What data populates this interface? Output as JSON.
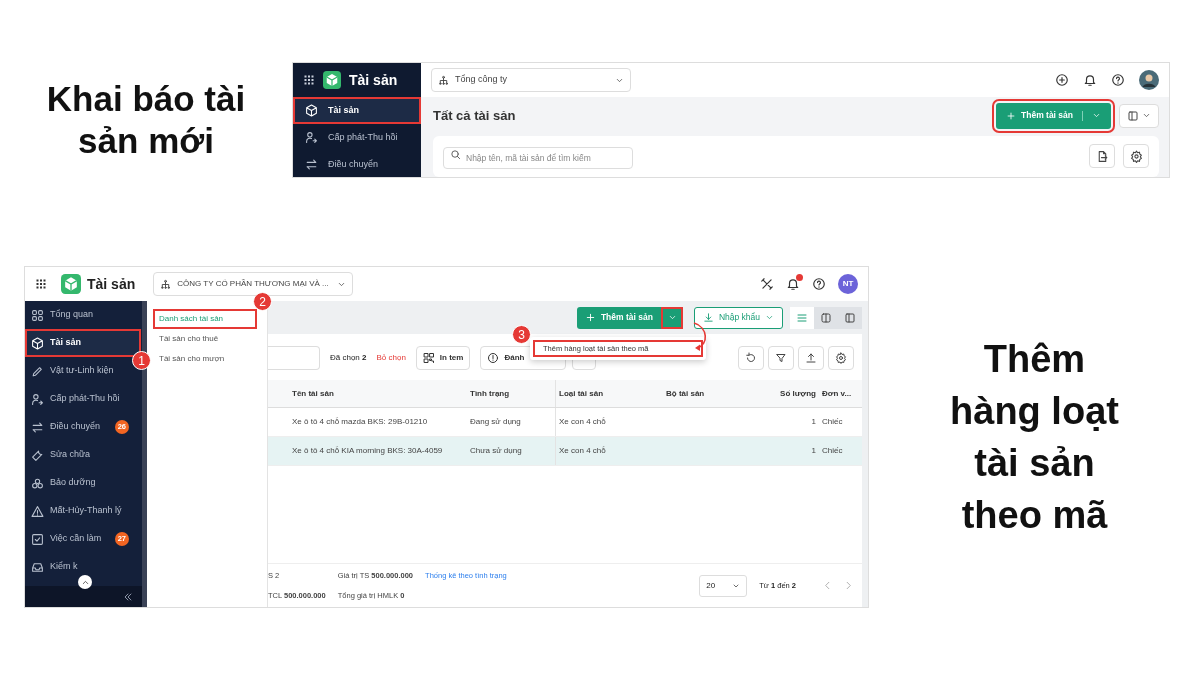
{
  "top_section": {
    "caption": "Khai báo tài sản mới",
    "app": {
      "app_name": "Tài sản",
      "company": "Tổng công ty",
      "sidebar": [
        {
          "label": "Tài sản",
          "selected": true,
          "highlighted": true
        },
        {
          "label": "Cấp phát-Thu hồi",
          "selected": false,
          "highlighted": false
        },
        {
          "label": "Điều chuyển",
          "selected": false,
          "highlighted": false
        }
      ],
      "page_title": "Tất cả tài sản",
      "add_button": {
        "label": "Thêm tài sản",
        "highlighted": true
      },
      "layout_toggle": {
        "selected": false
      },
      "search": {
        "placeholder": "Nhập tên, mã tài sản để tìm kiếm"
      }
    }
  },
  "bottom_section": {
    "caption": "Thêm hàng loạt tài sản theo mã",
    "app": {
      "app_name": "Tài sản",
      "company": "CÔNG TY CỔ PHẦN THƯƠNG MẠI VÀ ...",
      "avatar": "NT",
      "sidebar": [
        {
          "label": "Tổng quan",
          "selected": false,
          "highlighted": false
        },
        {
          "label": "Tài sản",
          "selected": true,
          "highlighted": true,
          "step": "1"
        },
        {
          "label": "Vật tư-Linh kiện",
          "selected": false,
          "highlighted": false
        },
        {
          "label": "Cấp phát-Thu hồi",
          "selected": false,
          "highlighted": false
        },
        {
          "label": "Điều chuyển",
          "selected": false,
          "highlighted": false,
          "badge": "26"
        },
        {
          "label": "Sửa chữa",
          "selected": false,
          "highlighted": false
        },
        {
          "label": "Bảo dưỡng",
          "selected": false,
          "highlighted": false
        },
        {
          "label": "Mất-Hủy-Thanh lý",
          "selected": false,
          "highlighted": false
        },
        {
          "label": "Việc cần làm",
          "selected": false,
          "highlighted": false,
          "badge": "27"
        },
        {
          "label": "Kiểm k",
          "selected": false,
          "highlighted": false
        }
      ],
      "submenu": [
        {
          "label": "Danh sách tài sản",
          "selected": true,
          "highlighted": true,
          "step": "2"
        },
        {
          "label": "Tài sản cho thuê",
          "selected": false,
          "highlighted": false
        },
        {
          "label": "Tài sản cho mượn",
          "selected": false,
          "highlighted": false
        }
      ],
      "add_button": {
        "label": "Thêm tài sản",
        "caret_highlighted": true
      },
      "import_button": "Nhập khẩu",
      "view_toggles": [
        {
          "selected": true
        },
        {
          "selected": false
        },
        {
          "selected": false
        }
      ],
      "dropdown": {
        "step": "3",
        "items": [
          {
            "label": "Thêm hàng loạt tài sản theo mã",
            "highlighted": true
          }
        ]
      },
      "selected_count": "Đã chọn **2**",
      "clear_selection": "Bỏ chọn",
      "actions": [
        "In tem",
        "Đánh"
      ],
      "table": {
        "columns": [
          "Tên tài sản",
          "Tình trạng",
          "Loại tài sản",
          "Bộ tài sản",
          "Số lượng",
          "Đơn v..."
        ],
        "rows": [
          {
            "selected": false,
            "cells": [
              "Xe ô tô 4 chỗ mazda BKS: 29B-01210",
              "Đang sử dụng",
              "Xe con 4 chỗ",
              "",
              "1",
              "Chiếc"
            ]
          },
          {
            "selected": true,
            "cells": [
              "Xe ô tô 4 chỗ KIA morning BKS: 30A-4059",
              "Chưa sử dụng",
              "Xe con 4 chỗ",
              "",
              "1",
              "Chiếc"
            ]
          }
        ]
      },
      "footer": {
        "totals": [
          [
            "S 2",
            "TCL **500.000.000**"
          ],
          [
            "Giá trị TS **500.000.000**",
            "Tổng giá trị HMLK **0**"
          ]
        ],
        "link": "Thống kê theo tình trạng",
        "page_size": "20",
        "range": "Từ **1** đến **2**"
      }
    }
  }
}
